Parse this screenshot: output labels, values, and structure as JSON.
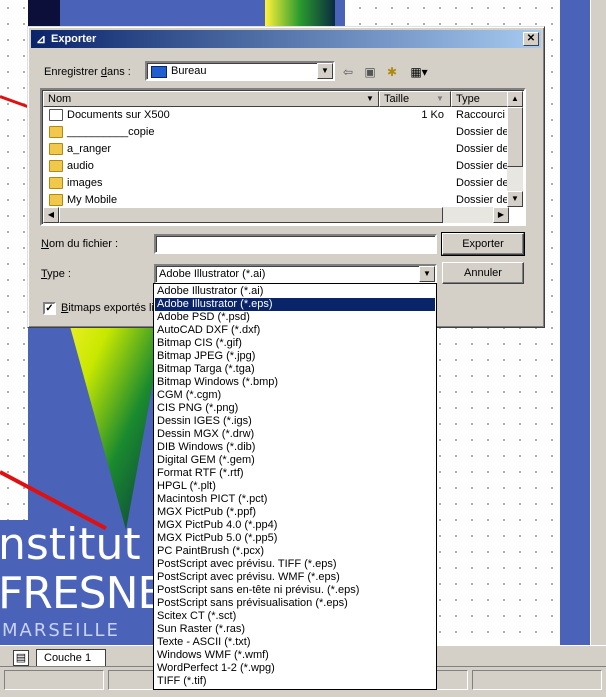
{
  "dialog": {
    "title": "Exporter",
    "save_in_label_pre": "Enregistrer ",
    "save_in_label_key": "d",
    "save_in_label_post": "ans :",
    "save_in_value": "Bureau",
    "toolbar_icons": [
      "back-arrow-icon",
      "up-folder-icon",
      "new-folder-icon",
      "view-menu-icon"
    ],
    "columns": {
      "name": "Nom",
      "size": "Taille",
      "type": "Type"
    },
    "files": [
      {
        "name": "Documents sur X500",
        "size": "1 Ko",
        "type": "Raccourci",
        "icon": "shortcut-icon"
      },
      {
        "name": "__________copie",
        "size": "",
        "type": "Dossier de f",
        "icon": "folder-icon"
      },
      {
        "name": "a_ranger",
        "size": "",
        "type": "Dossier de f",
        "icon": "folder-icon"
      },
      {
        "name": "audio",
        "size": "",
        "type": "Dossier de f",
        "icon": "folder-icon"
      },
      {
        "name": "images",
        "size": "",
        "type": "Dossier de f",
        "icon": "folder-icon"
      },
      {
        "name": "My Mobile",
        "size": "",
        "type": "Dossier de f",
        "icon": "folder-icon"
      }
    ],
    "filename_label_key": "N",
    "filename_label_rest": "om du fichier :",
    "filename_value": "",
    "type_label_key": "T",
    "type_label_rest": "ype :",
    "type_value": "Adobe Illustrator (*.ai)",
    "export_button": "Exporter",
    "cancel_button": "Annuler",
    "checkbox_label_key": "B",
    "checkbox_label_rest": "itmaps exportés lis",
    "checkbox_checked": true
  },
  "type_options": [
    "Adobe Illustrator (*.ai)",
    "Adobe Illustrator (*.eps)",
    "Adobe PSD (*.psd)",
    "AutoCAD DXF (*.dxf)",
    "Bitmap CIS (*.gif)",
    "Bitmap JPEG (*.jpg)",
    "Bitmap Targa (*.tga)",
    "Bitmap Windows (*.bmp)",
    "CGM (*.cgm)",
    "CIS PNG (*.png)",
    "Dessin IGES (*.igs)",
    "Dessin MGX (*.drw)",
    "DIB Windows (*.dib)",
    "Digital GEM (*.gem)",
    "Format RTF  (*.rtf)",
    "HPGL (*.plt)",
    "Macintosh PICT (*.pct)",
    "MGX PictPub (*.ppf)",
    "MGX PictPub 4.0 (*.pp4)",
    "MGX PictPub 5.0 (*.pp5)",
    "PC PaintBrush (*.pcx)",
    "PostScript avec prévisu. TIFF (*.eps)",
    "PostScript avec prévisu. WMF (*.eps)",
    "PostScript sans en-tête ni prévisu. (*.eps)",
    "PostScript sans prévisualisation (*.eps)",
    "Scitex CT (*.sct)",
    "Sun Raster (*.ras)",
    "Texte - ASCII (*.txt)",
    "Windows WMF (*.wmf)",
    "WordPerfect 1-2 (*.wpg)",
    "TIFF (*.tif)"
  ],
  "selected_type_index": 1,
  "background": {
    "logo_line1": "nstitut",
    "logo_line2": "FRESNEL",
    "logo_line3": "MARSEILLE"
  },
  "statusbar": {
    "layer_tab": "Couche 1"
  },
  "colors": {
    "titlebar": "#0a246a",
    "selection": "#0a246a",
    "poster_blue": "#4a63b8"
  }
}
